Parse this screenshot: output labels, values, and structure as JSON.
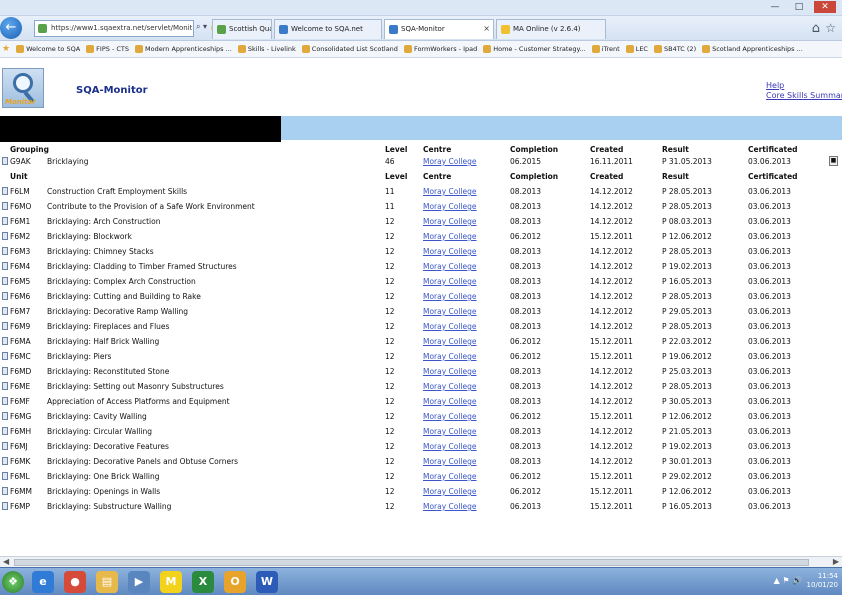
{
  "browser": {
    "address_text": "https://www1.sqaextra.net/servlet/Monit",
    "address_ctrls": "⌕ ▾ 🔒 C",
    "tabs": [
      {
        "label": "Scottish Qualific...",
        "color": "#5aa24a",
        "active": false
      },
      {
        "label": "Welcome to SQA.net",
        "color": "#3b79c9",
        "active": false
      },
      {
        "label": "SQA-Monitor",
        "color": "#3b79c9",
        "active": true
      },
      {
        "label": "MA Online (v 2.6.4)",
        "color": "#f0c030",
        "active": false
      }
    ],
    "favorites": [
      "Welcome to SQA",
      "FIPS - CTS",
      "Modern Apprenticeships ...",
      "Skills - Livelink",
      "Consolidated List Scotland",
      "FormWorkers - Ipad",
      "Home - Customer Strategy...",
      "iTrent",
      "LEC",
      "SB4TC (2)",
      "Scotland Apprenticeships ..."
    ]
  },
  "app": {
    "title": "SQA-Monitor",
    "logo_text": "Monitor",
    "help_label": "Help",
    "core_skills_label": "Core Skills Summar"
  },
  "table": {
    "group_headers": {
      "grouping": "Grouping",
      "level": "Level",
      "centre": "Centre",
      "completion": "Completion",
      "created": "Created",
      "result": "Result",
      "certificated": "Certificated"
    },
    "group_row": {
      "code": "G9AK",
      "title": "Bricklaying",
      "level": "46",
      "centre": "Moray College",
      "completion": "06.2015",
      "created": "16.11.2011",
      "result": "P   31.05.2013",
      "certificated": "03.06.2013"
    },
    "unit_headers": {
      "unit": "Unit",
      "level": "Level",
      "centre": "Centre",
      "completion": "Completion",
      "created": "Created",
      "result": "Result",
      "certificated": "Certificated"
    },
    "units": [
      {
        "code": "F6LM",
        "title": "Construction Craft Employment Skills",
        "level": "11",
        "centre": "Moray College",
        "completion": "08.2013",
        "created": "14.12.2012",
        "result": "P   28.05.2013",
        "certificated": "03.06.2013"
      },
      {
        "code": "F6MO",
        "title": "Contribute to the Provision of a Safe Work Environment",
        "level": "11",
        "centre": "Moray College",
        "completion": "08.2013",
        "created": "14.12.2012",
        "result": "P   28.05.2013",
        "certificated": "03.06.2013"
      },
      {
        "code": "F6M1",
        "title": "Bricklaying: Arch Construction",
        "level": "12",
        "centre": "Moray College",
        "completion": "08.2013",
        "created": "14.12.2012",
        "result": "P   08.03.2013",
        "certificated": "03.06.2013"
      },
      {
        "code": "F6M2",
        "title": "Bricklaying: Blockwork",
        "level": "12",
        "centre": "Moray College",
        "completion": "06.2012",
        "created": "15.12.2011",
        "result": "P   12.06.2012",
        "certificated": "03.06.2013"
      },
      {
        "code": "F6M3",
        "title": "Bricklaying: Chimney Stacks",
        "level": "12",
        "centre": "Moray College",
        "completion": "08.2013",
        "created": "14.12.2012",
        "result": "P   28.05.2013",
        "certificated": "03.06.2013"
      },
      {
        "code": "F6M4",
        "title": "Bricklaying: Cladding to Timber Framed Structures",
        "level": "12",
        "centre": "Moray College",
        "completion": "08.2013",
        "created": "14.12.2012",
        "result": "P   19.02.2013",
        "certificated": "03.06.2013"
      },
      {
        "code": "F6M5",
        "title": "Bricklaying: Complex Arch Construction",
        "level": "12",
        "centre": "Moray College",
        "completion": "08.2013",
        "created": "14.12.2012",
        "result": "P   16.05.2013",
        "certificated": "03.06.2013"
      },
      {
        "code": "F6M6",
        "title": "Bricklaying: Cutting and Building to Rake",
        "level": "12",
        "centre": "Moray College",
        "completion": "08.2013",
        "created": "14.12.2012",
        "result": "P   28.05.2013",
        "certificated": "03.06.2013"
      },
      {
        "code": "F6M7",
        "title": "Bricklaying: Decorative Ramp Walling",
        "level": "12",
        "centre": "Moray College",
        "completion": "08.2013",
        "created": "14.12.2012",
        "result": "P   29.05.2013",
        "certificated": "03.06.2013"
      },
      {
        "code": "F6M9",
        "title": "Bricklaying: Fireplaces and Flues",
        "level": "12",
        "centre": "Moray College",
        "completion": "08.2013",
        "created": "14.12.2012",
        "result": "P   28.05.2013",
        "certificated": "03.06.2013"
      },
      {
        "code": "F6MA",
        "title": "Bricklaying: Half Brick Walling",
        "level": "12",
        "centre": "Moray College",
        "completion": "06.2012",
        "created": "15.12.2011",
        "result": "P   22.03.2012",
        "certificated": "03.06.2013"
      },
      {
        "code": "F6MC",
        "title": "Bricklaying: Piers",
        "level": "12",
        "centre": "Moray College",
        "completion": "06.2012",
        "created": "15.12.2011",
        "result": "P   19.06.2012",
        "certificated": "03.06.2013"
      },
      {
        "code": "F6MD",
        "title": "Bricklaying: Reconstituted Stone",
        "level": "12",
        "centre": "Moray College",
        "completion": "08.2013",
        "created": "14.12.2012",
        "result": "P   25.03.2013",
        "certificated": "03.06.2013"
      },
      {
        "code": "F6ME",
        "title": "Bricklaying: Setting out Masonry Substructures",
        "level": "12",
        "centre": "Moray College",
        "completion": "08.2013",
        "created": "14.12.2012",
        "result": "P   28.05.2013",
        "certificated": "03.06.2013"
      },
      {
        "code": "F6MF",
        "title": "Appreciation of Access Platforms and Equipment",
        "level": "12",
        "centre": "Moray College",
        "completion": "08.2013",
        "created": "14.12.2012",
        "result": "P   30.05.2013",
        "certificated": "03.06.2013"
      },
      {
        "code": "F6MG",
        "title": "Bricklaying: Cavity Walling",
        "level": "12",
        "centre": "Moray College",
        "completion": "06.2012",
        "created": "15.12.2011",
        "result": "P   12.06.2012",
        "certificated": "03.06.2013"
      },
      {
        "code": "F6MH",
        "title": "Bricklaying: Circular Walling",
        "level": "12",
        "centre": "Moray College",
        "completion": "08.2013",
        "created": "14.12.2012",
        "result": "P   21.05.2013",
        "certificated": "03.06.2013"
      },
      {
        "code": "F6MJ",
        "title": "Bricklaying: Decorative Features",
        "level": "12",
        "centre": "Moray College",
        "completion": "08.2013",
        "created": "14.12.2012",
        "result": "P   19.02.2013",
        "certificated": "03.06.2013"
      },
      {
        "code": "F6MK",
        "title": "Bricklaying: Decorative Panels and Obtuse Corners",
        "level": "12",
        "centre": "Moray College",
        "completion": "08.2013",
        "created": "14.12.2012",
        "result": "P   30.01.2013",
        "certificated": "03.06.2013"
      },
      {
        "code": "F6ML",
        "title": "Bricklaying: One Brick Walling",
        "level": "12",
        "centre": "Moray College",
        "completion": "06.2012",
        "created": "15.12.2011",
        "result": "P   29.02.2012",
        "certificated": "03.06.2013"
      },
      {
        "code": "F6MM",
        "title": "Bricklaying: Openings in Walls",
        "level": "12",
        "centre": "Moray College",
        "completion": "06.2012",
        "created": "15.12.2011",
        "result": "P   12.06.2012",
        "certificated": "03.06.2013"
      },
      {
        "code": "F6MP",
        "title": "Bricklaying: Substructure Walling",
        "level": "12",
        "centre": "Moray College",
        "completion": "06.2013",
        "created": "15.12.2011",
        "result": "P   16.05.2013",
        "certificated": "03.06.2013"
      }
    ]
  },
  "taskbar": {
    "apps": [
      {
        "name": "ie-icon",
        "glyph": "e",
        "color": "#2f7bd6"
      },
      {
        "name": "chrome-icon",
        "glyph": "●",
        "color": "#d64a3a"
      },
      {
        "name": "explorer-folder-icon",
        "glyph": "▤",
        "color": "#e6b94a"
      },
      {
        "name": "media-icon",
        "glyph": "▶",
        "color": "#5a86c0"
      },
      {
        "name": "m-app-icon",
        "glyph": "M",
        "color": "#f2d21a"
      },
      {
        "name": "excel-icon",
        "glyph": "X",
        "color": "#2a8a3e"
      },
      {
        "name": "outlook-icon",
        "glyph": "O",
        "color": "#e8a32a"
      },
      {
        "name": "word-icon",
        "glyph": "W",
        "color": "#2c5cb8"
      }
    ],
    "clock_time": "11:54",
    "clock_date": "10/01/20"
  }
}
